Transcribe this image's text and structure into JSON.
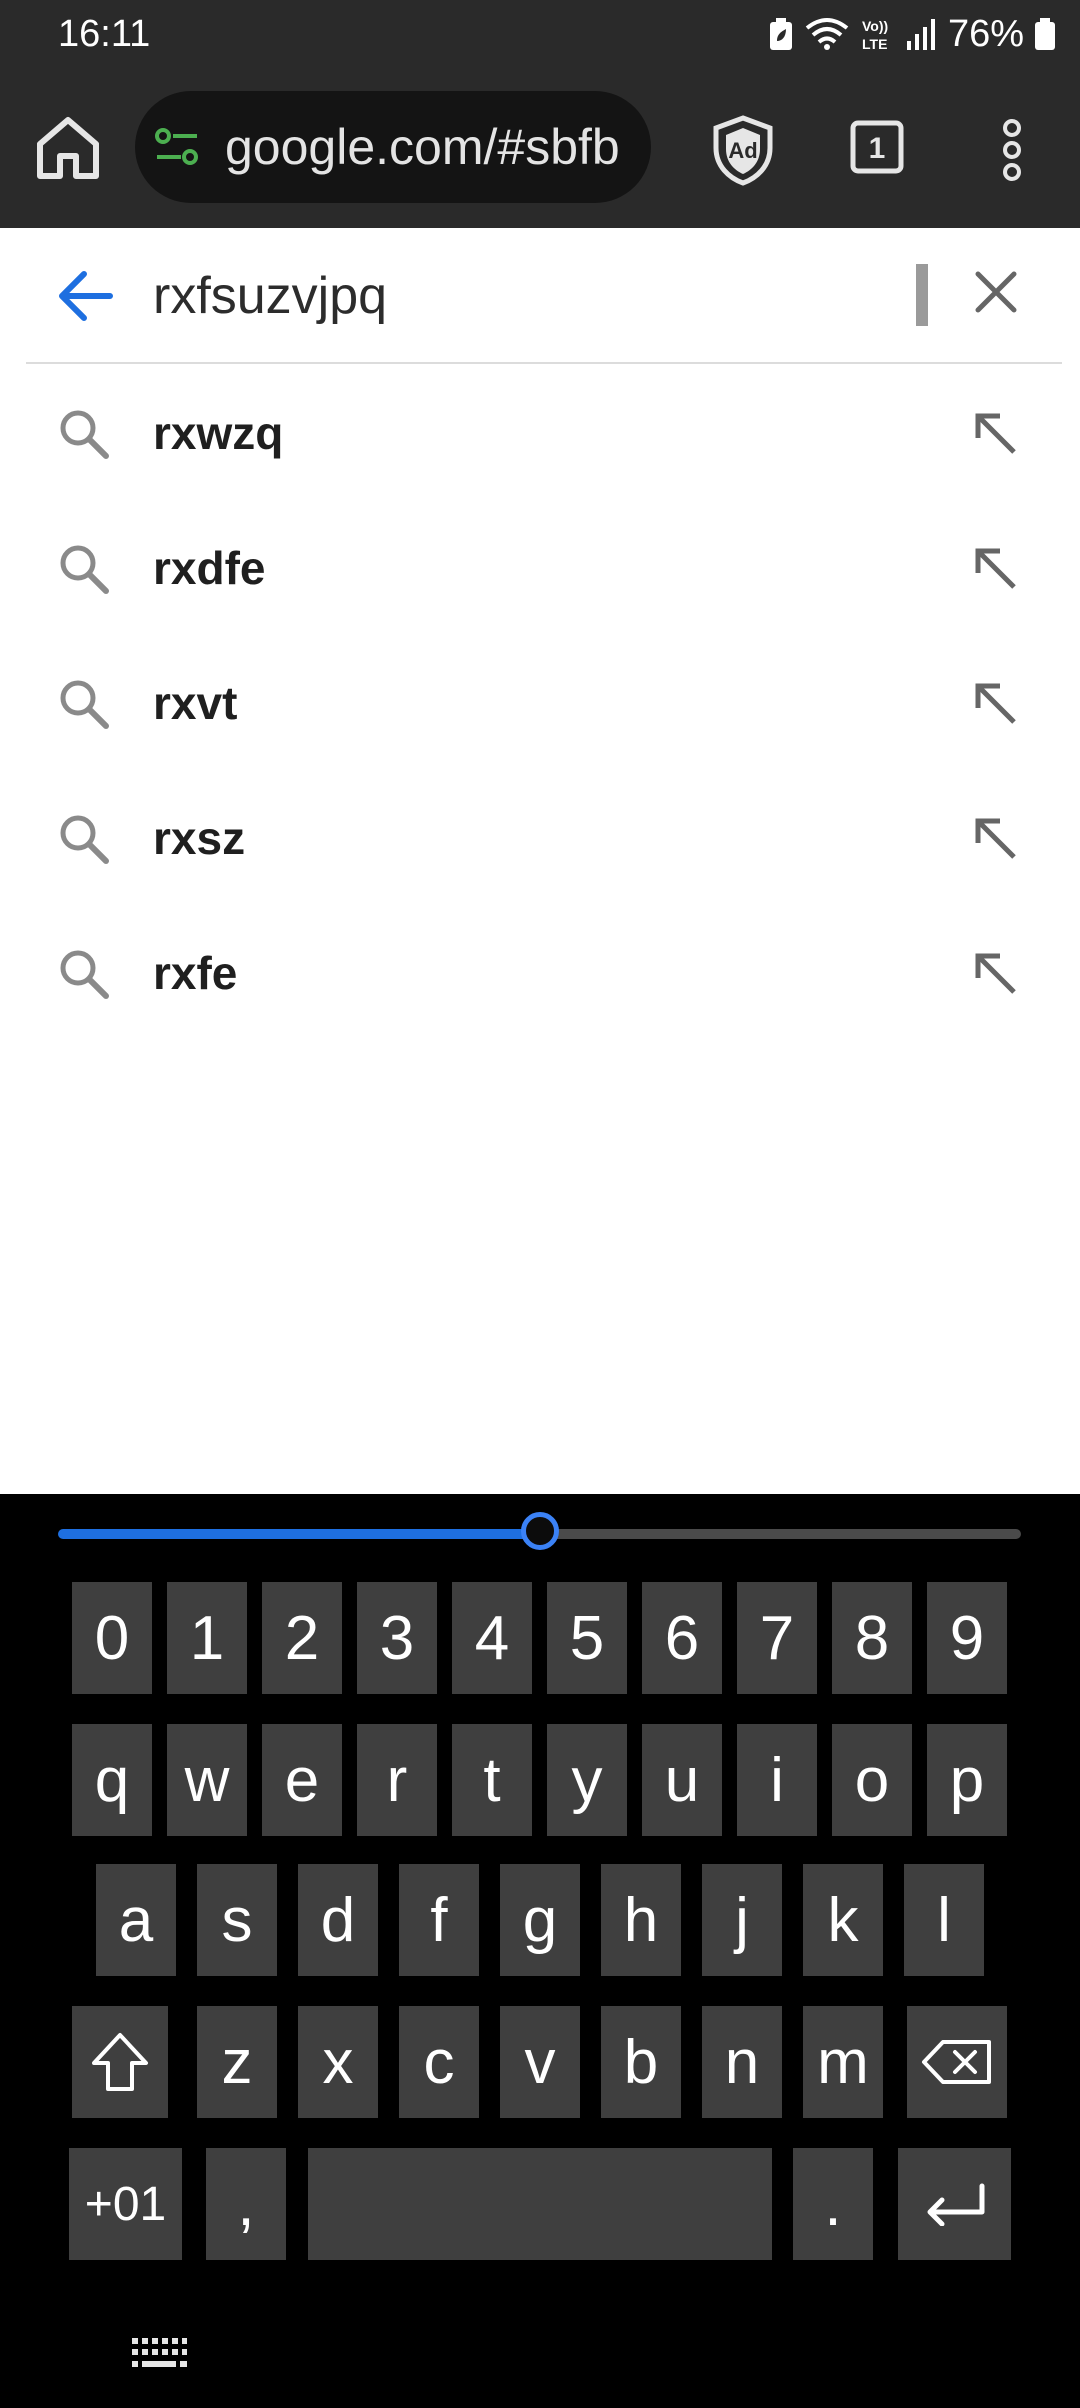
{
  "status_bar": {
    "time": "16:11",
    "battery": "76%",
    "icons": [
      "battery-saver-icon",
      "wifi-icon",
      "volte-icon",
      "signal-icon",
      "battery-icon"
    ],
    "volte_label": "Vo)) LTE"
  },
  "browser": {
    "url": "google.com/#sbfb",
    "tab_count": "1",
    "adblock_label": "Ad",
    "icons": [
      "home-icon",
      "site-settings-icon",
      "adblock-shield-icon",
      "tab-switcher-icon",
      "more-menu-icon"
    ]
  },
  "search": {
    "query": "rxfsuzvjpq",
    "icons": [
      "back-arrow-icon",
      "clear-icon"
    ]
  },
  "suggestions": [
    {
      "text": "rxwzq"
    },
    {
      "text": "rxdfe"
    },
    {
      "text": "rxvt"
    },
    {
      "text": "rxsz"
    },
    {
      "text": "rxfe"
    }
  ],
  "keyboard": {
    "slider_fraction": 0.5,
    "row_numbers": [
      "0",
      "1",
      "2",
      "3",
      "4",
      "5",
      "6",
      "7",
      "8",
      "9"
    ],
    "row_1": [
      "q",
      "w",
      "e",
      "r",
      "t",
      "y",
      "u",
      "i",
      "o",
      "p"
    ],
    "row_2": [
      "a",
      "s",
      "d",
      "f",
      "g",
      "h",
      "j",
      "k",
      "l"
    ],
    "row_3": [
      "z",
      "x",
      "c",
      "v",
      "b",
      "n",
      "m"
    ],
    "symbols_key": "+01",
    "comma_key": ",",
    "period_key": ".",
    "icons": [
      "shift-icon",
      "backspace-icon",
      "enter-icon",
      "keyboard-switch-icon"
    ]
  },
  "colors": {
    "accent": "#1e6fe0",
    "toolbar_bg": "#2a2a2a",
    "key_bg": "#3f3f3f",
    "url_icon": "#4caf50"
  }
}
